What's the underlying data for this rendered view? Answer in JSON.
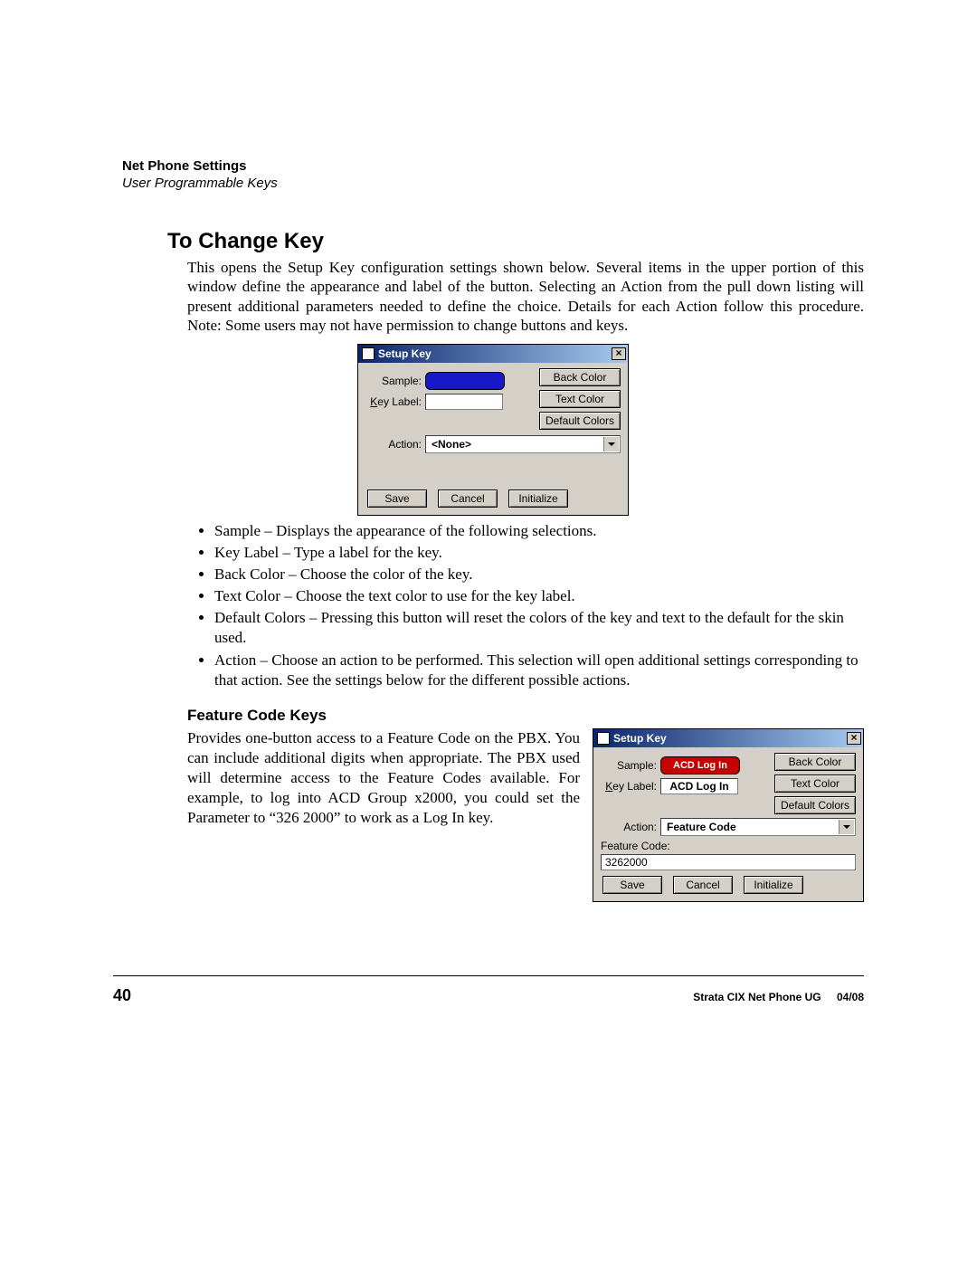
{
  "header": {
    "title": "Net Phone Settings",
    "subtitle": "User Programmable Keys"
  },
  "section": {
    "heading": "To Change Key",
    "intro": "This opens the Setup Key configuration settings shown below.   Several items in the upper portion of this window define the appearance and label of the button.  Selecting an Action from the pull down listing will present additional parameters needed to define the choice.  Details for each Action follow this procedure.   Note:  Some users may not have permission to change buttons and keys.",
    "bullets": [
      "Sample – Displays the appearance of the following selections.",
      "Key Label – Type a label for the key.",
      "Back Color – Choose the color of the key.",
      "Text Color – Choose the text color to use for the key label.",
      "Default Colors – Pressing this button will reset the colors of the key and text to the default for the skin used.",
      "Action – Choose an action to be performed.  This selection will open additional settings corresponding to that action.  See the settings below for the different possible actions."
    ]
  },
  "dialog1": {
    "title": "Setup Key",
    "labels": {
      "sample": "Sample:",
      "keylabel": "Key Label:",
      "action": "Action:"
    },
    "buttons": {
      "backColor": "Back Color",
      "textColor": "Text Color",
      "defaultColors": "Default Colors",
      "save": "Save",
      "cancel": "Cancel",
      "initialize": "Initialize"
    },
    "action_value": "<None>",
    "keylabel_value": ""
  },
  "feature": {
    "heading": "Feature Code Keys",
    "text": "Provides one-button access to a Feature Code on the PBX. You can include additional digits when appropriate.  The PBX used will determine access to the Feature Codes available.  For example, to log into ACD Group x2000, you could set the Parameter to “326 2000” to work as a Log In key."
  },
  "dialog2": {
    "title": "Setup Key",
    "labels": {
      "sample": "Sample:",
      "keylabel": "Key Label:",
      "action": "Action:",
      "fcode": "Feature Code:"
    },
    "sample_text": "ACD Log In",
    "keylabel_value": "ACD Log In",
    "action_value": "Feature Code",
    "fcode_value": "3262000",
    "buttons": {
      "backColor": "Back Color",
      "textColor": "Text Color",
      "defaultColors": "Default Colors",
      "save": "Save",
      "cancel": "Cancel",
      "initialize": "Initialize"
    }
  },
  "footer": {
    "page": "40",
    "docTitle": "Strata CIX Net Phone UG",
    "date": "04/08"
  }
}
